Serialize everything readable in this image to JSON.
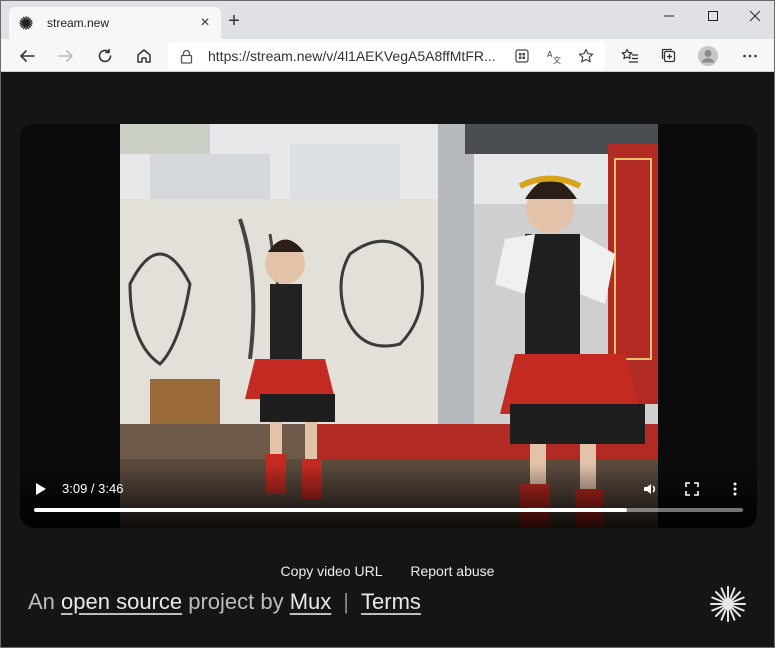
{
  "browser": {
    "tab": {
      "title": "stream.new"
    },
    "address": {
      "url": "https://stream.new/v/4l1AEKVegA5A8ffMtFR..."
    }
  },
  "player": {
    "time_display": "3:09 / 3:46",
    "progress": 0.836
  },
  "footer": {
    "copy_url_label": "Copy video URL",
    "report_label": "Report abuse",
    "credit_prefix": "An ",
    "credit_link_open_source": "open source",
    "credit_middle": " project by ",
    "credit_link_mux": "Mux",
    "separator": "|",
    "credit_link_terms": "Terms"
  },
  "colors": {
    "page_background": "#151515",
    "tab_strip": "#dfe1e5",
    "toolbar": "#f7f7f7"
  }
}
